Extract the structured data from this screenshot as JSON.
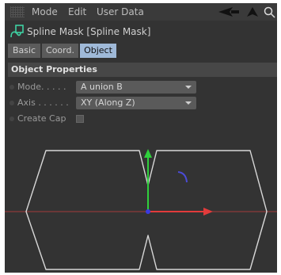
{
  "menubar": {
    "items": [
      "Mode",
      "Edit",
      "User Data"
    ]
  },
  "title": "Spline Mask [Spline Mask]",
  "tabs": [
    {
      "label": "Basic",
      "active": false
    },
    {
      "label": "Coord.",
      "active": false
    },
    {
      "label": "Object",
      "active": true
    }
  ],
  "section_header": "Object Properties",
  "properties": {
    "mode": {
      "label": "Mode. . . . .",
      "value": "A union B"
    },
    "axis": {
      "label": "Axis . . . . . .",
      "value": "XY (Along Z)"
    },
    "create_cap": {
      "label": "Create Cap",
      "checked": false
    }
  },
  "colors": {
    "background": "#333333",
    "active_tab": "#9fb9d8",
    "spline_outline": "#d8d8d8",
    "x_axis": "#e23b3b",
    "y_axis": "#2fcf3c",
    "rotate_handle": "#4b4bd6"
  },
  "icons": {
    "menu": "grip-icon",
    "nav": [
      "arrow-left-icon",
      "arrow-up-icon",
      "search-icon"
    ],
    "title": "spline-mask-icon"
  }
}
